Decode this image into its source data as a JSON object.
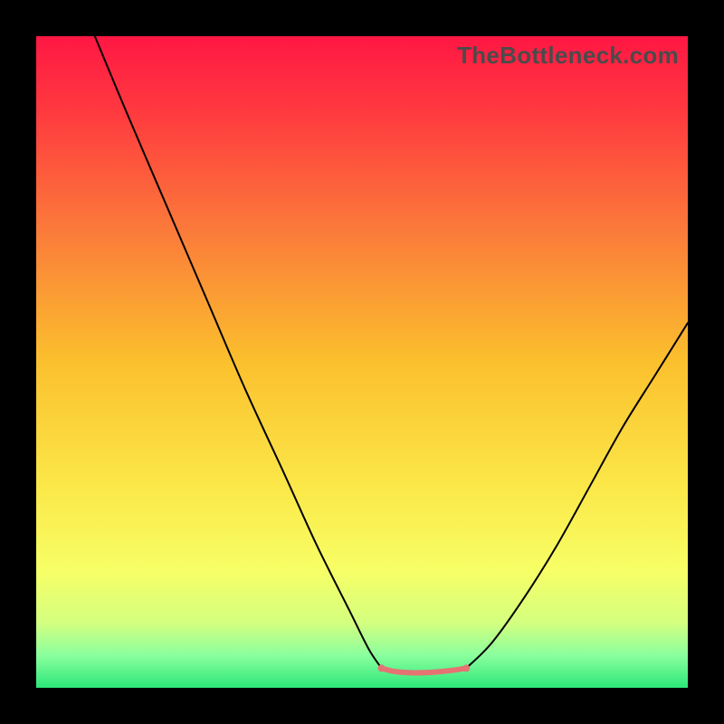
{
  "watermark": {
    "text": "TheBottleneck.com"
  },
  "chart_data": {
    "type": "line",
    "title": "",
    "xlabel": "",
    "ylabel": "",
    "xlim": [
      0,
      100
    ],
    "ylim": [
      0,
      100
    ],
    "grid": false,
    "legend": false,
    "gradient_stops": [
      {
        "offset": 0.0,
        "color": "#FF1744"
      },
      {
        "offset": 0.12,
        "color": "#FF3B3F"
      },
      {
        "offset": 0.3,
        "color": "#FB7B3A"
      },
      {
        "offset": 0.5,
        "color": "#FBC02D"
      },
      {
        "offset": 0.7,
        "color": "#FBE94A"
      },
      {
        "offset": 0.82,
        "color": "#F7FF66"
      },
      {
        "offset": 0.9,
        "color": "#D4FF7F"
      },
      {
        "offset": 0.95,
        "color": "#8AFF9E"
      },
      {
        "offset": 1.0,
        "color": "#2CE77A"
      }
    ],
    "series": [
      {
        "name": "curve-left",
        "stroke": "#000000",
        "points": [
          {
            "x": 9,
            "y": 100
          },
          {
            "x": 14,
            "y": 88
          },
          {
            "x": 20,
            "y": 74
          },
          {
            "x": 26,
            "y": 60
          },
          {
            "x": 32,
            "y": 46
          },
          {
            "x": 38,
            "y": 33
          },
          {
            "x": 43,
            "y": 22
          },
          {
            "x": 48,
            "y": 12
          },
          {
            "x": 51,
            "y": 6
          },
          {
            "x": 53,
            "y": 3
          }
        ]
      },
      {
        "name": "pink-flat",
        "stroke": "#E57373",
        "stroke_width": 6,
        "points": [
          {
            "x": 53,
            "y": 3
          },
          {
            "x": 55,
            "y": 2.5
          },
          {
            "x": 58,
            "y": 2.3
          },
          {
            "x": 61,
            "y": 2.4
          },
          {
            "x": 64,
            "y": 2.7
          },
          {
            "x": 66,
            "y": 3
          }
        ]
      },
      {
        "name": "curve-right",
        "stroke": "#000000",
        "points": [
          {
            "x": 66,
            "y": 3
          },
          {
            "x": 70,
            "y": 7
          },
          {
            "x": 75,
            "y": 14
          },
          {
            "x": 80,
            "y": 22
          },
          {
            "x": 85,
            "y": 31
          },
          {
            "x": 90,
            "y": 40
          },
          {
            "x": 95,
            "y": 48
          },
          {
            "x": 100,
            "y": 56
          }
        ]
      }
    ],
    "markers": [
      {
        "x": 53,
        "y": 3,
        "color": "#E57373",
        "r": 4
      },
      {
        "x": 66,
        "y": 3,
        "color": "#E57373",
        "r": 4
      }
    ]
  }
}
